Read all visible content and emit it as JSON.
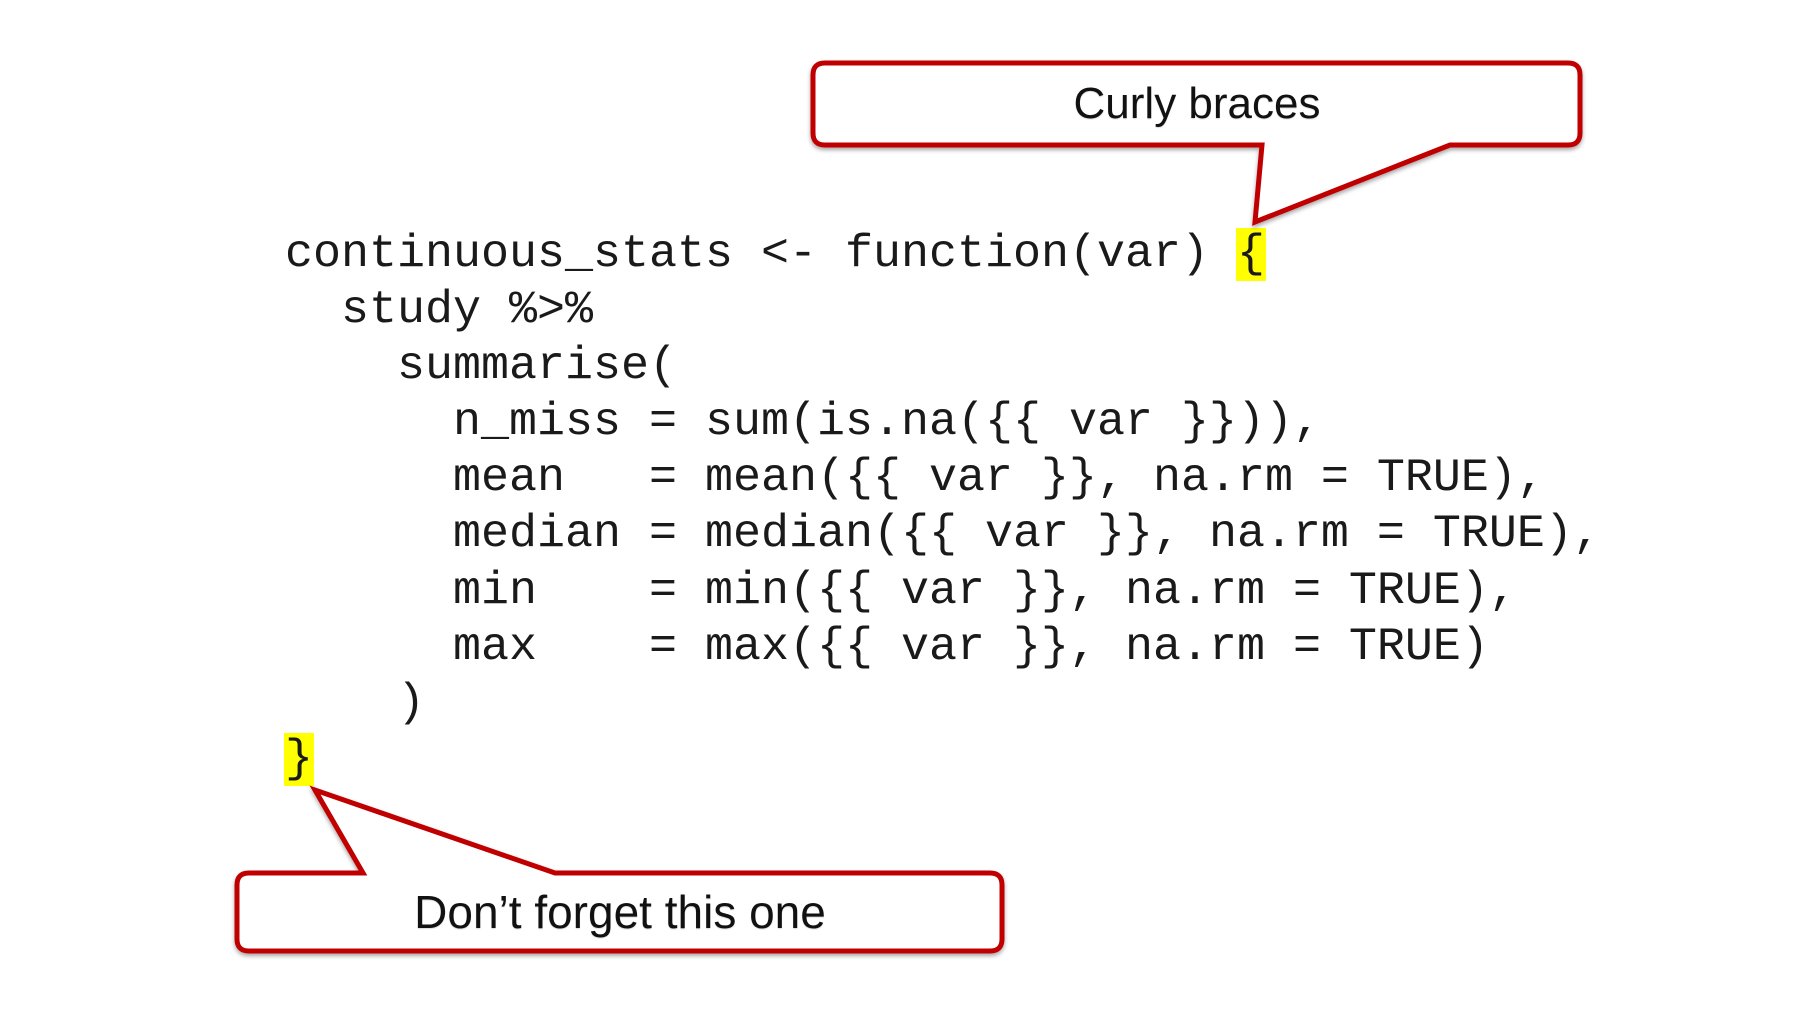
{
  "code": {
    "lines": [
      {
        "text": "continuous_stats <- function(var) ",
        "highlight": "{"
      },
      {
        "text": "  study %>%"
      },
      {
        "text": "    summarise("
      },
      {
        "text": "      n_miss = sum(is.na({{ var }})),"
      },
      {
        "text": "      mean   = mean({{ var }}, na.rm = TRUE),"
      },
      {
        "text": "      median = median({{ var }}, na.rm = TRUE),"
      },
      {
        "text": "      min    = min({{ var }}, na.rm = TRUE),"
      },
      {
        "text": "      max    = max({{ var }}, na.rm = TRUE)"
      },
      {
        "text": "    )"
      },
      {
        "text": "",
        "highlight": "}"
      }
    ]
  },
  "callouts": {
    "top": {
      "label": "Curly braces"
    },
    "bottom": {
      "label": "Don’t forget this one"
    }
  },
  "colors": {
    "callout_border": "#c00000",
    "highlight": "#ffff00",
    "code_text": "#1a1a1a",
    "background": "#ffffff"
  }
}
